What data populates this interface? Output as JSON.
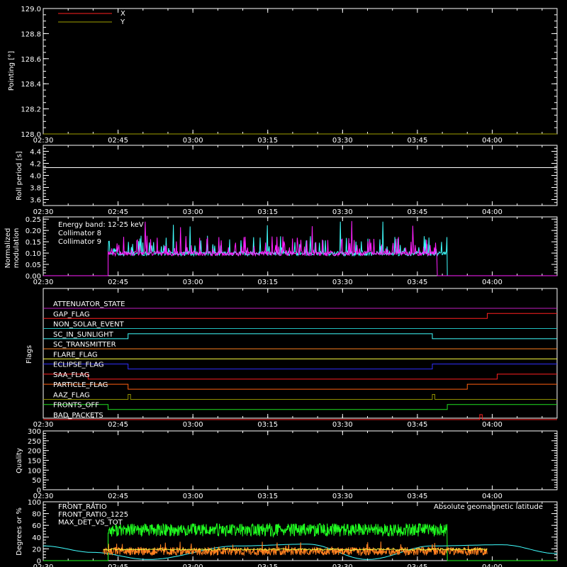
{
  "time_ticks": [
    "02:30",
    "02:45",
    "03:00",
    "03:15",
    "03:30",
    "03:45",
    "04:00"
  ],
  "time_domain": [
    "02:30",
    "04:13"
  ],
  "colors": {
    "white": "#ffffff",
    "red": "#ff2020",
    "olive": "#a0a000",
    "cyan": "#40ffff",
    "magenta": "#ff20ff",
    "orange": "#ff8020",
    "yellow": "#ffff40",
    "blue": "#3030ff",
    "green": "#20ff20",
    "purple": "#c020c0",
    "darkcyan": "#20c0c0",
    "gold": "#ffd020",
    "darkorange": "#ff6010",
    "khaki": "#909000",
    "brightgreen": "#20e020"
  },
  "chart_data": [
    {
      "id": "pointing",
      "type": "line",
      "ylabel": "Pointing [°]",
      "ylim": [
        128.0,
        129.0
      ],
      "y_ticks": [
        "128.0",
        "128.2",
        "128.4",
        "128.6",
        "128.8",
        "129.0"
      ],
      "legend": [
        {
          "name": "X",
          "color": "#ff2020"
        },
        {
          "name": "Y",
          "color": "#a0a000"
        }
      ],
      "series": [
        {
          "name": "X",
          "color": "#ff2020",
          "x": [
            "02:30",
            "04:13"
          ],
          "y": [
            128.0,
            128.0
          ]
        },
        {
          "name": "Y",
          "color": "#a0a000",
          "x": [
            "02:30",
            "04:13"
          ],
          "y": [
            128.0,
            128.0
          ]
        }
      ]
    },
    {
      "id": "roll",
      "type": "line",
      "ylabel": "Roll period [s]",
      "ylim": [
        3.5,
        4.5
      ],
      "y_ticks": [
        "3.6",
        "3.8",
        "4.0",
        "4.2",
        "4.4"
      ],
      "series": [
        {
          "name": "roll",
          "color": "#ffffff",
          "x": [
            "02:30",
            "04:13"
          ],
          "y": [
            4.13,
            4.13
          ]
        }
      ]
    },
    {
      "id": "modulation",
      "type": "line",
      "ylabel_lines": [
        "Normalized",
        "modulation"
      ],
      "ylim": [
        0.0,
        0.26
      ],
      "y_ticks": [
        "0.00",
        "0.05",
        "0.10",
        "0.15",
        "0.20",
        "0.25"
      ],
      "legend_title": "Energy band: 12-25 keV",
      "legend": [
        {
          "name": "Collimator 8",
          "color": "#40ffff"
        },
        {
          "name": "Collimator 9",
          "color": "#ff20ff"
        }
      ],
      "active_range": [
        "02:43",
        "03:51"
      ],
      "baseline": 0.092,
      "active_ends": [
        {
          "name": "Collimator 8",
          "end": "03:51"
        },
        {
          "name": "Collimator 9",
          "end": "03:49"
        }
      ]
    },
    {
      "id": "flags",
      "type": "step",
      "ylabel": "Flags",
      "flags": [
        {
          "name": "ATTENUATOR_STATE",
          "color": "#c020c0",
          "transitions": [
            [
              "02:30",
              0
            ]
          ]
        },
        {
          "name": "GAP_FLAG",
          "color": "#ff2020",
          "transitions": [
            [
              "02:30",
              0
            ],
            [
              "03:59",
              1
            ]
          ]
        },
        {
          "name": "NON_SOLAR_EVENT",
          "color": "#20c0c0",
          "transitions": [
            [
              "02:30",
              0
            ]
          ]
        },
        {
          "name": "SC_IN_SUNLIGHT",
          "color": "#40ffff",
          "transitions": [
            [
              "02:30",
              0
            ],
            [
              "02:47",
              1
            ],
            [
              "03:48",
              0
            ]
          ]
        },
        {
          "name": "SC_TRANSMITTER",
          "color": "#ff8020",
          "transitions": [
            [
              "02:30",
              0
            ]
          ]
        },
        {
          "name": "FLARE_FLAG",
          "color": "#ffff40",
          "transitions": [
            [
              "02:30",
              0
            ]
          ]
        },
        {
          "name": "ECLIPSE_FLAG",
          "color": "#3030ff",
          "transitions": [
            [
              "02:30",
              1
            ],
            [
              "02:47",
              0
            ],
            [
              "03:48",
              1
            ]
          ]
        },
        {
          "name": "SAA_FLAG",
          "color": "#ff2020",
          "transitions": [
            [
              "02:30",
              1
            ],
            [
              "02:39",
              0
            ],
            [
              "04:01",
              1
            ]
          ]
        },
        {
          "name": "PARTICLE_FLAG",
          "color": "#ff6010",
          "transitions": [
            [
              "02:30",
              1
            ],
            [
              "02:47",
              0
            ],
            [
              "03:55",
              1
            ]
          ]
        },
        {
          "name": "AAZ_FLAG",
          "color": "#909000",
          "transitions": [
            [
              "02:30",
              0
            ],
            [
              "02:47",
              1
            ],
            [
              "02:47.5",
              0
            ],
            [
              "03:48",
              1
            ],
            [
              "03:48.5",
              0
            ]
          ]
        },
        {
          "name": "FRONTS_OFF",
          "color": "#20e020",
          "transitions": [
            [
              "02:30",
              1
            ],
            [
              "02:43",
              0
            ],
            [
              "03:51",
              1
            ]
          ]
        },
        {
          "name": "BAD_PACKETS",
          "color": "#ff2020",
          "transitions": [
            [
              "02:30",
              0
            ],
            [
              "03:57.5",
              1
            ],
            [
              "03:58",
              0
            ]
          ]
        }
      ]
    },
    {
      "id": "quality",
      "type": "line",
      "ylabel": "Quality",
      "ylim": [
        0,
        300
      ],
      "y_ticks": [
        "0",
        "50",
        "100",
        "150",
        "200",
        "250",
        "300"
      ],
      "series": []
    },
    {
      "id": "ratios",
      "type": "line",
      "ylabel": "Degrees or %",
      "ylim": [
        0,
        100
      ],
      "y_ticks": [
        "0",
        "20",
        "40",
        "60",
        "80",
        "100"
      ],
      "legend": [
        {
          "name": "FRONT_RATIO",
          "color": "#ffff40"
        },
        {
          "name": "FRONT_RATIO_1225",
          "color": "#20ff20"
        },
        {
          "name": "MAX_DET_VS_TOT",
          "color": "#ff8020"
        }
      ],
      "annotation": {
        "text": "Absolute geomagnetic latitude",
        "color": "#40ffff"
      },
      "front_ratio_1225": {
        "range": [
          "02:43",
          "03:51"
        ],
        "mean": 52,
        "before": 0,
        "after": 0
      },
      "max_det_vs_tot": {
        "range": [
          "02:42",
          "03:59"
        ],
        "mean": 16
      },
      "front_ratio": {
        "range": [
          "02:42",
          "03:59"
        ],
        "mean": 19
      },
      "latitude": {
        "x": [
          "02:30",
          "02:40",
          "02:51",
          "03:09",
          "03:23",
          "03:35",
          "03:48",
          "04:02",
          "04:13"
        ],
        "y": [
          25,
          14,
          2,
          25,
          28,
          2,
          25,
          27,
          12
        ]
      }
    }
  ]
}
